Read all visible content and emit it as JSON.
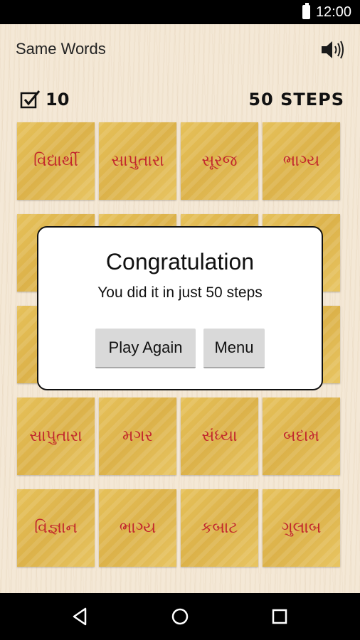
{
  "status_bar": {
    "time": "12:00"
  },
  "app": {
    "title": "Same Words"
  },
  "score": {
    "matched": "10",
    "steps": "50 STEPS"
  },
  "tiles": [
    "વિદ્યાર્થી",
    "સાપુતારા",
    "સૂરજ",
    "ભાગ્ય",
    "",
    "",
    "",
    "",
    "",
    "",
    "",
    "",
    "સાપુતારા",
    "મગર",
    "સંધ્યા",
    "બદામ",
    "વિજ્ઞાન",
    "ભાગ્ય",
    "કબાટ",
    "ગુલાબ"
  ],
  "dialog": {
    "title": "Congratulation",
    "message": "You did it in just 50 steps",
    "play_again_label": "Play Again",
    "menu_label": "Menu"
  },
  "colors": {
    "tile_text": "#c2272d",
    "tile_bg": "#e2bb55",
    "background": "#f3e7d6"
  },
  "icons": {
    "sound": "speaker-icon",
    "score": "checkbox-icon",
    "nav": [
      "back-icon",
      "home-icon",
      "recents-icon"
    ]
  }
}
